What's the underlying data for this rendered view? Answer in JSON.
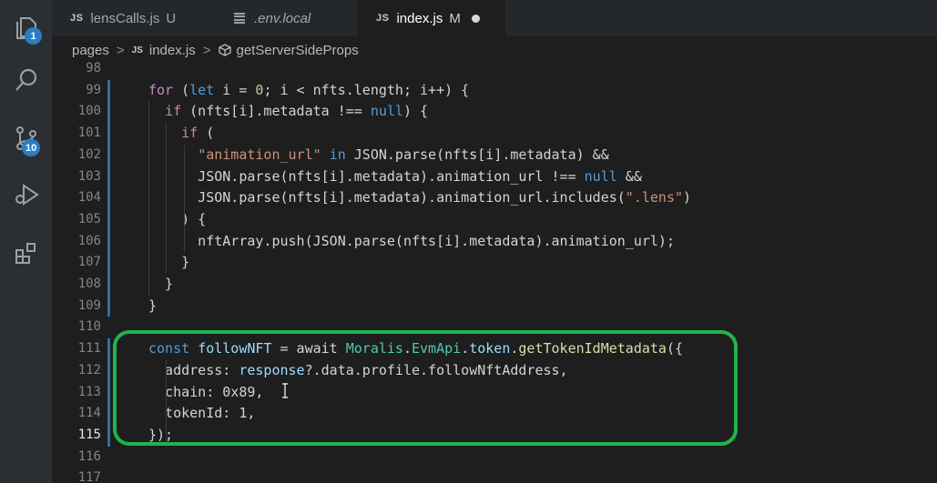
{
  "activity_bar": {
    "explorer_badge": "1",
    "source_control_badge": "10"
  },
  "tabs": [
    {
      "label": "lensCalls.js",
      "icon": "JS",
      "status": "U"
    },
    {
      "label": ".env.local",
      "icon": "settings-lines-icon",
      "status": ""
    },
    {
      "label": "index.js",
      "icon": "JS",
      "status": "M"
    }
  ],
  "breadcrumb": {
    "folder": "pages",
    "file_icon": "JS",
    "file": "index.js",
    "symbol": "getServerSideProps",
    "separator": ">"
  },
  "editor": {
    "lines": [
      {
        "n": "98",
        "tokens": []
      },
      {
        "n": "99",
        "tokens": [
          [
            "ctl",
            "for"
          ],
          [
            "plain",
            " ("
          ],
          [
            "kw",
            "let"
          ],
          [
            "plain",
            " i = "
          ],
          [
            "num",
            "0"
          ],
          [
            "plain",
            "; i < nfts.length; i++) {"
          ]
        ]
      },
      {
        "n": "100",
        "tokens": [
          [
            "plain",
            "  "
          ],
          [
            "ctl",
            "if"
          ],
          [
            "plain",
            " (nfts[i].metadata !== "
          ],
          [
            "kw",
            "null"
          ],
          [
            "plain",
            ") {"
          ]
        ]
      },
      {
        "n": "101",
        "tokens": [
          [
            "plain",
            "    "
          ],
          [
            "ctl",
            "if"
          ],
          [
            "plain",
            " ("
          ]
        ]
      },
      {
        "n": "102",
        "tokens": [
          [
            "plain",
            "      "
          ],
          [
            "str",
            "\"animation_url\""
          ],
          [
            "plain",
            " "
          ],
          [
            "kw",
            "in"
          ],
          [
            "plain",
            " JSON.parse(nfts[i].metadata) &&"
          ]
        ]
      },
      {
        "n": "103",
        "tokens": [
          [
            "plain",
            "      JSON.parse(nfts[i].metadata).animation_url !== "
          ],
          [
            "kw",
            "null"
          ],
          [
            "plain",
            " &&"
          ]
        ]
      },
      {
        "n": "104",
        "tokens": [
          [
            "plain",
            "      JSON.parse(nfts[i].metadata).animation_url.includes("
          ],
          [
            "str",
            "\".lens\""
          ],
          [
            "plain",
            ")"
          ]
        ]
      },
      {
        "n": "105",
        "tokens": [
          [
            "plain",
            "    ) {"
          ]
        ]
      },
      {
        "n": "106",
        "tokens": [
          [
            "plain",
            "      nftArray.push(JSON.parse(nfts[i].metadata).animation_url);"
          ]
        ]
      },
      {
        "n": "107",
        "tokens": [
          [
            "plain",
            "    }"
          ]
        ]
      },
      {
        "n": "108",
        "tokens": [
          [
            "plain",
            "  }"
          ]
        ]
      },
      {
        "n": "109",
        "tokens": [
          [
            "plain",
            "}"
          ]
        ]
      },
      {
        "n": "110",
        "tokens": []
      },
      {
        "n": "111",
        "tokens": [
          [
            "kw",
            "const"
          ],
          [
            "plain",
            " "
          ],
          [
            "var",
            "followNFT"
          ],
          [
            "plain",
            " = await "
          ],
          [
            "cls",
            "Moralis"
          ],
          [
            "plain",
            "."
          ],
          [
            "cls",
            "EvmApi"
          ],
          [
            "plain",
            "."
          ],
          [
            "var",
            "token"
          ],
          [
            "plain",
            "."
          ],
          [
            "fn",
            "getTokenIdMetadata"
          ],
          [
            "plain",
            "({"
          ]
        ]
      },
      {
        "n": "112",
        "tokens": [
          [
            "plain",
            "  address: "
          ],
          [
            "var",
            "response"
          ],
          [
            "plain",
            "?.data.profile.followNftAddress,"
          ]
        ]
      },
      {
        "n": "113",
        "tokens": [
          [
            "plain",
            "  chain: 0x89,"
          ]
        ]
      },
      {
        "n": "114",
        "tokens": [
          [
            "plain",
            "  tokenId: 1,"
          ]
        ]
      },
      {
        "n": "115",
        "tokens": [
          [
            "plain",
            "});"
          ]
        ]
      },
      {
        "n": "116",
        "tokens": []
      },
      {
        "n": "117",
        "tokens": []
      }
    ],
    "current_line": "115"
  },
  "colors": {
    "highlight_border": "#22b24c",
    "badge": "#2b7dc6",
    "modified_gutter": "#2f6fa6"
  }
}
